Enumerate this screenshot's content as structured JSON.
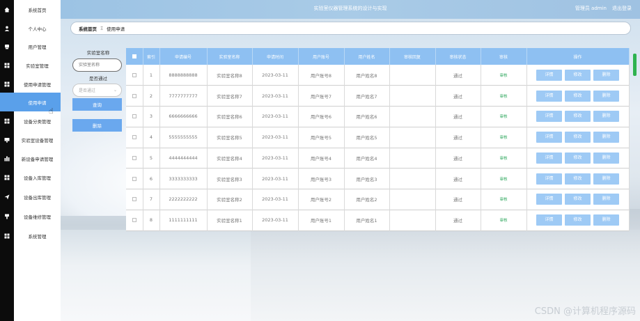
{
  "header": {
    "title": "实验室仪器管理系统的设计与实现",
    "user": "管理员 admin",
    "logout": "退出登录"
  },
  "sidebar": {
    "items": [
      {
        "label": "系统首页",
        "icon": "home-icon"
      },
      {
        "label": "个人中心",
        "icon": "user-icon"
      },
      {
        "label": "用户管理",
        "icon": "users-icon"
      },
      {
        "label": "实验室管理",
        "icon": "grid-icon"
      },
      {
        "label": "使用申请管理",
        "icon": "grid-icon"
      },
      {
        "label": "使用申请",
        "icon": "",
        "active": true
      },
      {
        "label": "设备分类管理",
        "icon": "grid-icon"
      },
      {
        "label": "实验室设备管理",
        "icon": "monitor-icon"
      },
      {
        "label": "新设备申请管理",
        "icon": "chart-icon"
      },
      {
        "label": "设备入库管理",
        "icon": "grid-icon"
      },
      {
        "label": "设备出库管理",
        "icon": "send-icon"
      },
      {
        "label": "设备维修管理",
        "icon": "tool-icon"
      },
      {
        "label": "系统管理",
        "icon": "grid-icon"
      }
    ]
  },
  "breadcrumb": {
    "home": "系统首页",
    "sep": "Ξ",
    "current": "使用申请"
  },
  "search": {
    "lab_name_label": "实验室名称",
    "lab_name_placeholder": "实验室名称",
    "approved_label": "是否通过",
    "approved_placeholder": "是否通过",
    "query_button": "查询",
    "delete_button": "删除"
  },
  "table": {
    "headers": [
      "索引",
      "申请编号",
      "实验室名称",
      "申请时间",
      "用户账号",
      "用户姓名",
      "审核回复",
      "审核状态",
      "审核",
      "操作"
    ],
    "audit_label": "审核",
    "actions": {
      "detail": "详情",
      "edit": "修改",
      "delete": "删除"
    },
    "rows": [
      {
        "index": "1",
        "number": "8888888888",
        "lab": "实验室名称8",
        "date": "2023-03-11",
        "account": "用户账号8",
        "name": "用户姓名8",
        "reply": "",
        "status": "通过"
      },
      {
        "index": "2",
        "number": "7777777777",
        "lab": "实验室名称7",
        "date": "2023-03-11",
        "account": "用户账号7",
        "name": "用户姓名7",
        "reply": "",
        "status": "通过"
      },
      {
        "index": "3",
        "number": "6666666666",
        "lab": "实验室名称6",
        "date": "2023-03-11",
        "account": "用户账号6",
        "name": "用户姓名6",
        "reply": "",
        "status": "通过"
      },
      {
        "index": "4",
        "number": "5555555555",
        "lab": "实验室名称5",
        "date": "2023-03-11",
        "account": "用户账号5",
        "name": "用户姓名5",
        "reply": "",
        "status": "通过"
      },
      {
        "index": "5",
        "number": "4444444444",
        "lab": "实验室名称4",
        "date": "2023-03-11",
        "account": "用户账号4",
        "name": "用户姓名4",
        "reply": "",
        "status": "通过"
      },
      {
        "index": "6",
        "number": "3333333333",
        "lab": "实验室名称3",
        "date": "2023-03-11",
        "account": "用户账号3",
        "name": "用户姓名3",
        "reply": "",
        "status": "通过"
      },
      {
        "index": "7",
        "number": "2222222222",
        "lab": "实验室名称2",
        "date": "2023-03-11",
        "account": "用户账号2",
        "name": "用户姓名2",
        "reply": "",
        "status": "通过"
      },
      {
        "index": "8",
        "number": "1111111111",
        "lab": "实验室名称1",
        "date": "2023-03-11",
        "account": "用户账号1",
        "name": "用户姓名1",
        "reply": "",
        "status": "通过"
      }
    ]
  },
  "watermark": "CSDN @计算机程序源码",
  "colors": {
    "accent": "#5aa0ea",
    "table_header": "#8ec0f2",
    "action_button": "#9ecaf5",
    "audit_link": "#2aa65a"
  }
}
